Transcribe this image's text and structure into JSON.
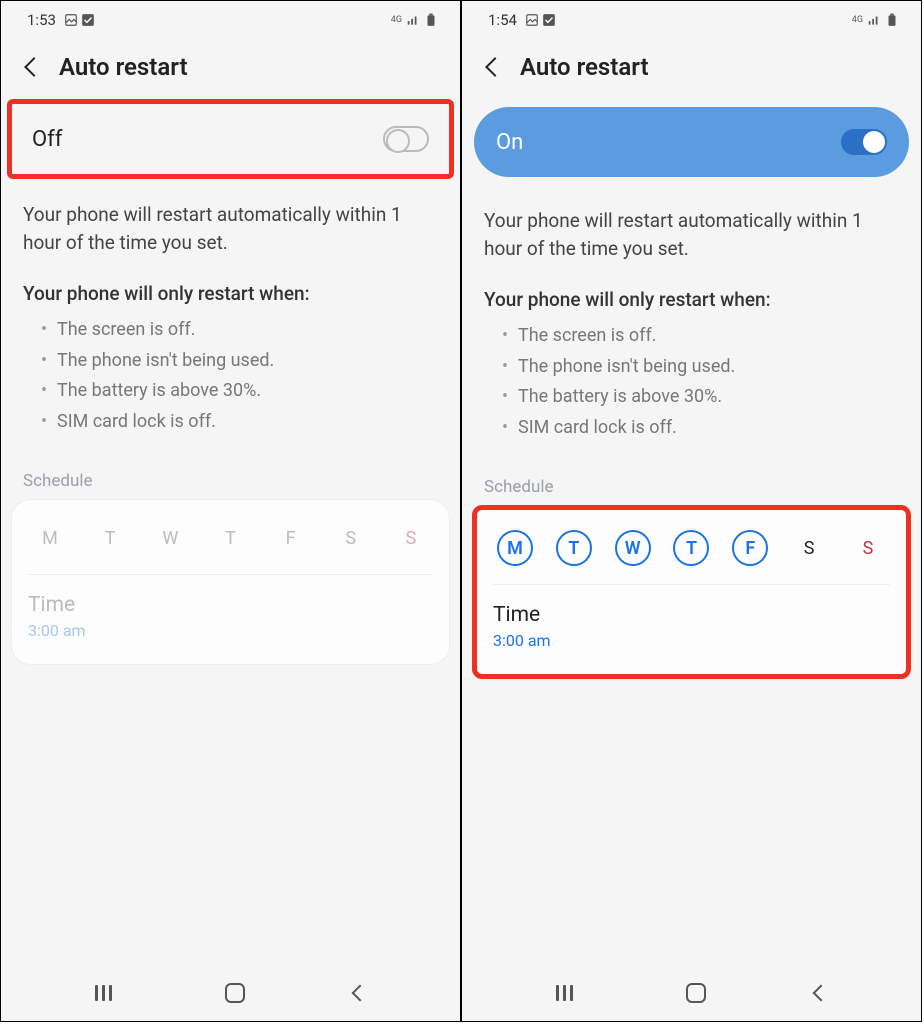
{
  "left": {
    "status": {
      "time": "1:53",
      "net": "4G"
    },
    "header": {
      "title": "Auto restart"
    },
    "toggle": {
      "label": "Off"
    },
    "info": {
      "main": "Your phone will restart automatically within 1 hour of the time you set.",
      "subtitle": "Your phone will only restart when:",
      "conditions": [
        "The screen is off.",
        "The phone isn't being used.",
        "The battery is above 30%.",
        "SIM card lock is off."
      ]
    },
    "schedule": {
      "label": "Schedule",
      "days": [
        "M",
        "T",
        "W",
        "T",
        "F",
        "S",
        "S"
      ],
      "time_label": "Time",
      "time_value": "3:00 am"
    }
  },
  "right": {
    "status": {
      "time": "1:54",
      "net": "4G"
    },
    "header": {
      "title": "Auto restart"
    },
    "toggle": {
      "label": "On"
    },
    "info": {
      "main": "Your phone will restart automatically within 1 hour of the time you set.",
      "subtitle": "Your phone will only restart when:",
      "conditions": [
        "The screen is off.",
        "The phone isn't being used.",
        "The battery is above 30%.",
        "SIM card lock is off."
      ]
    },
    "schedule": {
      "label": "Schedule",
      "days": [
        "M",
        "T",
        "W",
        "T",
        "F",
        "S",
        "S"
      ],
      "time_label": "Time",
      "time_value": "3:00 am"
    }
  }
}
